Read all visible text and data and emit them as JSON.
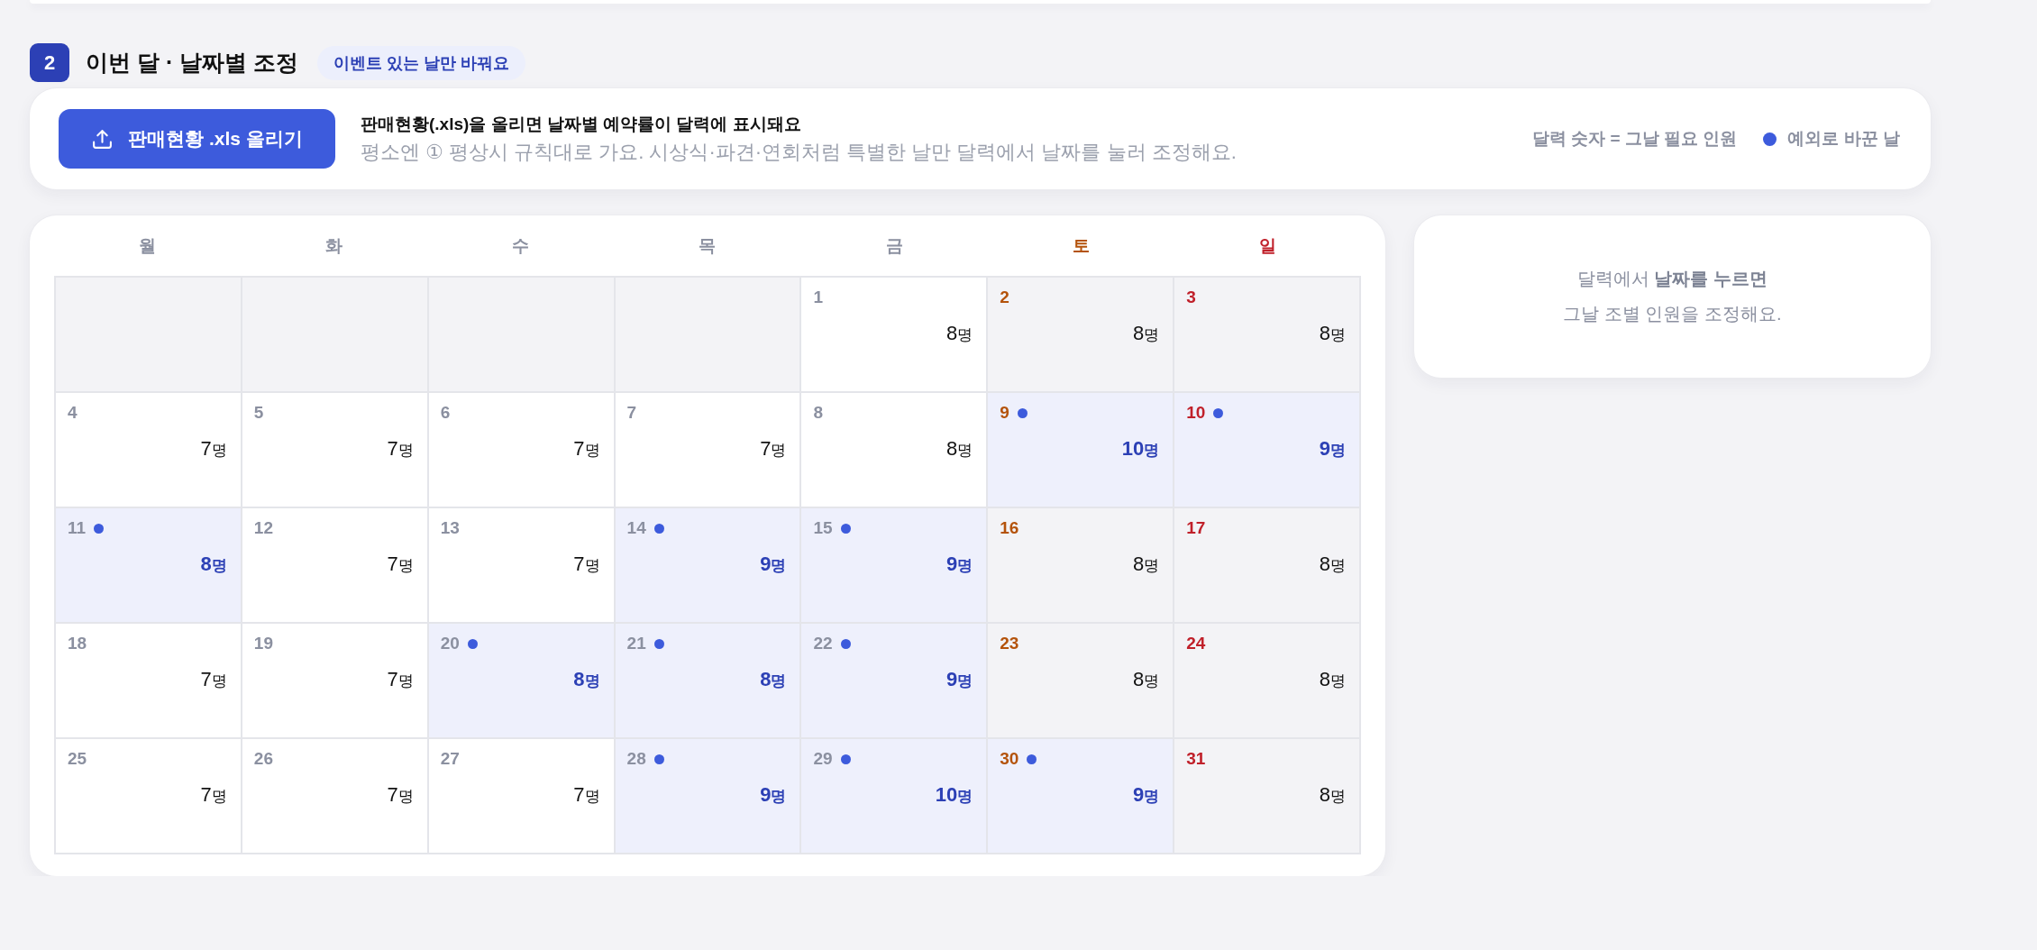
{
  "section": {
    "number": "2",
    "title": "이번 달 · 날짜별 조정",
    "tag": "이벤트 있는 날만 바꿔요"
  },
  "upload": {
    "button": "판매현황 .xls 올리기",
    "headline": "판매현황(.xls)을 올리면 날짜별 예약률이 달력에 표시돼요",
    "note": "평소엔 ① 평상시 규칙대로 가요. 시상식·파견·연회처럼 특별한 날만 달력에서 날짜를 눌러 조정해요.",
    "legend": [
      {
        "kind": "text",
        "label": "달력 숫자 = 그날 필요 인원"
      },
      {
        "kind": "dot",
        "label": "예외로 바꾼 날",
        "color": "#3d5bdc"
      }
    ]
  },
  "calendar": {
    "weekdays": [
      {
        "label": "월",
        "kind": "weekday"
      },
      {
        "label": "화",
        "kind": "weekday"
      },
      {
        "label": "수",
        "kind": "weekday"
      },
      {
        "label": "목",
        "kind": "weekday"
      },
      {
        "label": "금",
        "kind": "weekday"
      },
      {
        "label": "토",
        "kind": "saturday"
      },
      {
        "label": "일",
        "kind": "sunday"
      }
    ],
    "weeks": [
      {
        "days": [
          {
            "kind": "empty"
          },
          {
            "kind": "empty"
          },
          {
            "kind": "empty"
          },
          {
            "kind": "empty"
          },
          {
            "kind": "day",
            "date": "1",
            "count": "8",
            "unit": "명",
            "exception": false
          },
          {
            "kind": "day",
            "date": "2",
            "count": "8",
            "unit": "명",
            "exception": false
          },
          {
            "kind": "day",
            "date": "3",
            "count": "8",
            "unit": "명",
            "exception": false
          }
        ]
      },
      {
        "days": [
          {
            "kind": "day",
            "date": "4",
            "count": "7",
            "unit": "명",
            "exception": false
          },
          {
            "kind": "day",
            "date": "5",
            "count": "7",
            "unit": "명",
            "exception": false
          },
          {
            "kind": "day",
            "date": "6",
            "count": "7",
            "unit": "명",
            "exception": false
          },
          {
            "kind": "day",
            "date": "7",
            "count": "7",
            "unit": "명",
            "exception": false
          },
          {
            "kind": "day",
            "date": "8",
            "count": "8",
            "unit": "명",
            "exception": false
          },
          {
            "kind": "day",
            "date": "9",
            "count": "10",
            "unit": "명",
            "exception": true
          },
          {
            "kind": "day",
            "date": "10",
            "count": "9",
            "unit": "명",
            "exception": true
          }
        ]
      },
      {
        "days": [
          {
            "kind": "day",
            "date": "11",
            "count": "8",
            "unit": "명",
            "exception": true
          },
          {
            "kind": "day",
            "date": "12",
            "count": "7",
            "unit": "명",
            "exception": false
          },
          {
            "kind": "day",
            "date": "13",
            "count": "7",
            "unit": "명",
            "exception": false
          },
          {
            "kind": "day",
            "date": "14",
            "count": "9",
            "unit": "명",
            "exception": true
          },
          {
            "kind": "day",
            "date": "15",
            "count": "9",
            "unit": "명",
            "exception": true
          },
          {
            "kind": "day",
            "date": "16",
            "count": "8",
            "unit": "명",
            "exception": false
          },
          {
            "kind": "day",
            "date": "17",
            "count": "8",
            "unit": "명",
            "exception": false
          }
        ]
      },
      {
        "days": [
          {
            "kind": "day",
            "date": "18",
            "count": "7",
            "unit": "명",
            "exception": false
          },
          {
            "kind": "day",
            "date": "19",
            "count": "7",
            "unit": "명",
            "exception": false
          },
          {
            "kind": "day",
            "date": "20",
            "count": "8",
            "unit": "명",
            "exception": true
          },
          {
            "kind": "day",
            "date": "21",
            "count": "8",
            "unit": "명",
            "exception": true
          },
          {
            "kind": "day",
            "date": "22",
            "count": "9",
            "unit": "명",
            "exception": true
          },
          {
            "kind": "day",
            "date": "23",
            "count": "8",
            "unit": "명",
            "exception": false
          },
          {
            "kind": "day",
            "date": "24",
            "count": "8",
            "unit": "명",
            "exception": false
          }
        ]
      },
      {
        "days": [
          {
            "kind": "day",
            "date": "25",
            "count": "7",
            "unit": "명",
            "exception": false
          },
          {
            "kind": "day",
            "date": "26",
            "count": "7",
            "unit": "명",
            "exception": false
          },
          {
            "kind": "day",
            "date": "27",
            "count": "7",
            "unit": "명",
            "exception": false
          },
          {
            "kind": "day",
            "date": "28",
            "count": "9",
            "unit": "명",
            "exception": true
          },
          {
            "kind": "day",
            "date": "29",
            "count": "10",
            "unit": "명",
            "exception": true
          },
          {
            "kind": "day",
            "date": "30",
            "count": "9",
            "unit": "명",
            "exception": true
          },
          {
            "kind": "day",
            "date": "31",
            "count": "8",
            "unit": "명",
            "exception": false
          }
        ]
      }
    ]
  },
  "info": {
    "lines": [
      "달력에서 **날짜를 누르면**",
      "그날 조별 인원을 조정해요."
    ]
  }
}
